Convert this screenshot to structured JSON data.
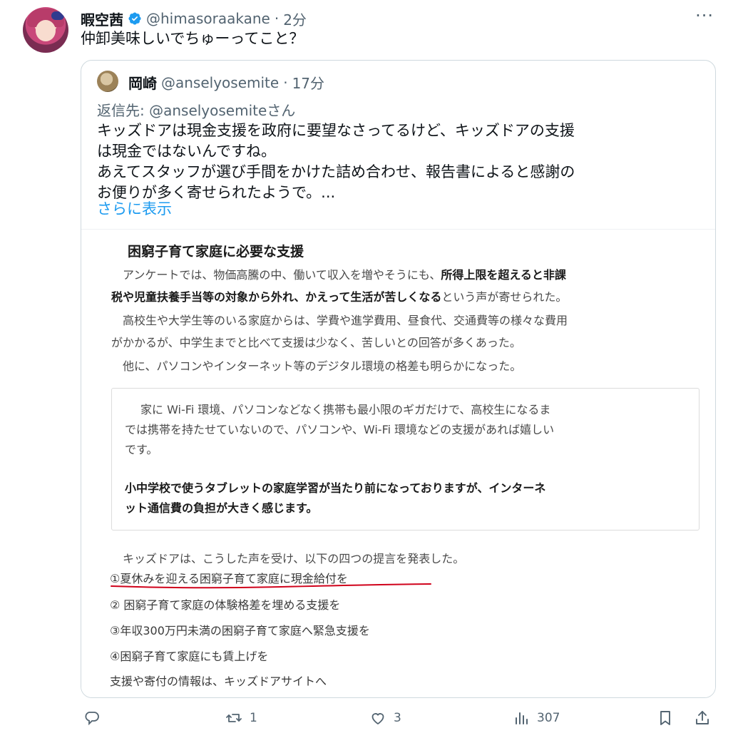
{
  "tweet": {
    "author_name": "暇空茜",
    "author_handle": "@himasoraakane",
    "separator": "·",
    "time": "2分",
    "more": "···",
    "text": "仲卸美味しいでちゅーってこと？"
  },
  "quote": {
    "author_name": "岡崎",
    "author_handle": "@anselyosemite",
    "separator": "·",
    "time": "17分",
    "reply_to": "返信先: @anselyosemiteさん",
    "body_lines": [
      "キッズドアは現金支援を政府に要望なさってるけど、キッズドアの支援",
      "は現金ではないんですね。",
      "あえてスタッフが選び手間をかけた詰め合わせ、報告書によると感謝の",
      "お便りが多く寄せられたようで。..."
    ],
    "show_more": "さらに表示"
  },
  "document": {
    "title": "困窮子育て家庭に必要な支援",
    "para1_line1_a": "アンケートでは、物価高騰の中、働いて収入を増やそうにも、",
    "para1_line1_b": "所得上限を超えると非課",
    "para1_line2_b": "税や児童扶養手当等の対象から外れ、かえって生活が苦しくなる",
    "para1_line2_c": "という声が寄せられた。",
    "para2_line1": "高校生や大学生等のいる家庭からは、学費や進学費用、昼食代、交通費等の様々な費用",
    "para2_line2": "がかかるが、中学生までと比べて支援は少なく、苦しいとの回答が多くあった。",
    "para3": "他に、パソコンやインターネット等のデジタル環境の格差も明らかになった。",
    "quote_box": {
      "p1_line1": "家に Wi-Fi 環境、パソコンなどなく携帯も最小限のギガだけで、高校生になるま",
      "p1_line2": "では携帯を持たせていないので、パソコンや、Wi-Fi 環境などの支援があれば嬉しい",
      "p1_line3": "です。",
      "p2_line1": "小中学校で使うタブレットの家庭学習が当たり前になっておりますが、インターネ",
      "p2_line2": "ット通信費の負担が大きく感じます。"
    },
    "para4": "キッズドアは、こうした声を受け、以下の四つの提言を発表した。",
    "proposals": [
      "①夏休みを迎える困窮子育て家庭に現金給付を",
      "② 困窮子育て家庭の体験格差を埋める支援を",
      "③年収300万円未満の困窮子育て家庭へ緊急支援を",
      "④困窮子育て家庭にも賃上げを"
    ],
    "footer": "支援や寄付の情報は、キッズドアサイトへ",
    "underline_color": "#d0021b"
  },
  "actions": {
    "reply_count": "",
    "retweet_count": "1",
    "like_count": "3",
    "views_count": "307"
  },
  "colors": {
    "text": "#0f1419",
    "muted": "#536471",
    "link": "#1d9bf0",
    "verified": "#1d9bf0",
    "border": "#cfd9de"
  }
}
